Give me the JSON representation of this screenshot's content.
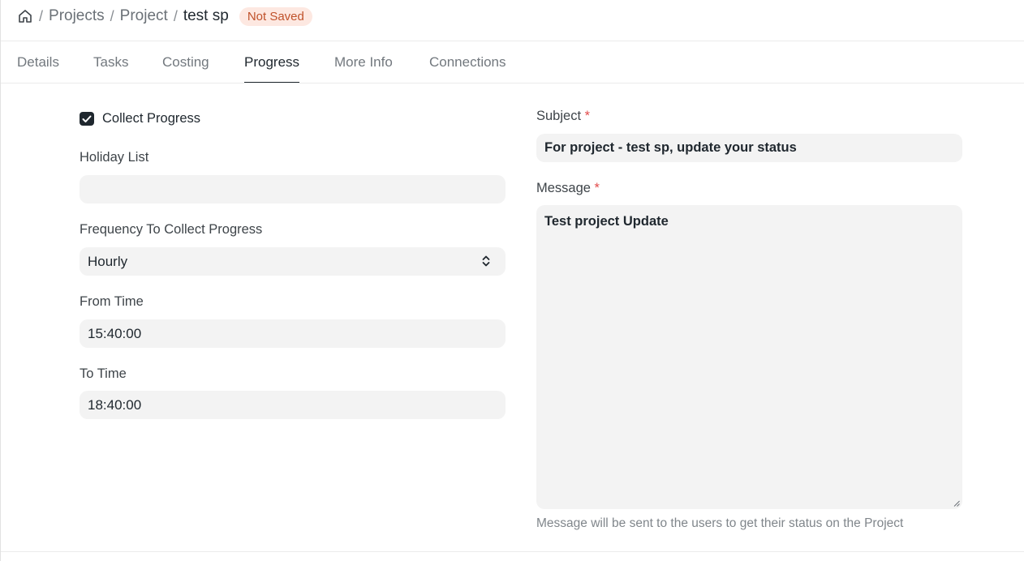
{
  "breadcrumb": {
    "home_icon": "home-icon",
    "items": [
      "Projects",
      "Project"
    ],
    "current": "test sp",
    "separator": "/",
    "status_badge": "Not Saved"
  },
  "tabs": [
    {
      "label": "Details",
      "active": false
    },
    {
      "label": "Tasks",
      "active": false
    },
    {
      "label": "Costing",
      "active": false
    },
    {
      "label": "Progress",
      "active": true
    },
    {
      "label": "More Info",
      "active": false
    },
    {
      "label": "Connections",
      "active": false
    }
  ],
  "left": {
    "collect_progress": {
      "label": "Collect Progress",
      "checked": true
    },
    "holiday_list": {
      "label": "Holiday List",
      "value": ""
    },
    "frequency": {
      "label": "Frequency To Collect Progress",
      "value": "Hourly"
    },
    "from_time": {
      "label": "From Time",
      "value": "15:40:00"
    },
    "to_time": {
      "label": "To Time",
      "value": "18:40:00"
    }
  },
  "right": {
    "subject": {
      "label": "Subject",
      "required_mark": "*",
      "value": "For project - test sp, update your status"
    },
    "message": {
      "label": "Message",
      "required_mark": "*",
      "value": "Test project Update",
      "help": "Message will be sent to the users to get their status on the Project"
    }
  },
  "colors": {
    "badge_text": "#c0522b",
    "badge_bg": "#fde8e1",
    "required": "#e24c4c",
    "input_bg": "#f3f3f3"
  }
}
